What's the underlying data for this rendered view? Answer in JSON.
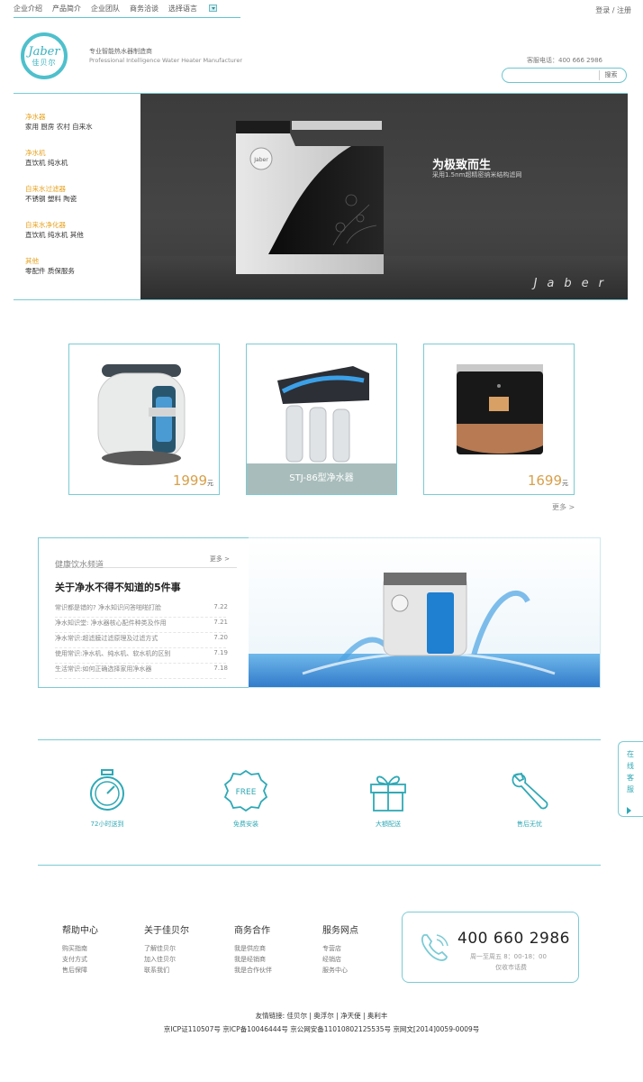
{
  "top_nav": {
    "items": [
      "企业介绍",
      "产品简介",
      "企业团队",
      "商务洽谈",
      "选择语言"
    ],
    "login": "登录 / 注册"
  },
  "header": {
    "logo_text": "Jaber",
    "logo_cn": "佳贝尔",
    "tagline_cn": "专业智能热水器制造商",
    "tagline_en": "Professional Intelligence Water Heater Manufacturer",
    "hotline": "客服电话：400 666 2986",
    "search_placeholder": "",
    "search_button": "搜索"
  },
  "sidebar": {
    "categories": [
      {
        "title": "净水器",
        "subs": "家用  厨房  农村  自来水"
      },
      {
        "title": "净水机",
        "subs": "直饮机  纯水机"
      },
      {
        "title": "自来水过滤器",
        "subs": "不锈钢  塑料  陶瓷"
      },
      {
        "title": "自来水净化器",
        "subs": "直饮机  纯水机  其他"
      },
      {
        "title": "其他",
        "subs": "零配件  质保服务"
      }
    ]
  },
  "banner": {
    "title": "为极致而生",
    "subtitle": "采用1.5nm超精密纳米结构滤网",
    "brand": "Jaber",
    "product_logo": "Jaber"
  },
  "products": [
    {
      "price": "1999",
      "unit": "元"
    },
    {
      "caption": "STJ-86型净水器"
    },
    {
      "price": "1699",
      "unit": "元"
    }
  ],
  "products_more": "更多 >",
  "news": {
    "heading": "健康饮水频道",
    "more": "更多 >",
    "title": "关于净水不得不知道的5件事",
    "items": [
      {
        "text": "常识都是错的? 净水知识问答啪啪打脸",
        "date": "7.22"
      },
      {
        "text": "净水知识堂: 净水器核心配件种类及作用",
        "date": "7.21"
      },
      {
        "text": "净水常识:超滤膜过滤原理及过滤方式",
        "date": "7.20"
      },
      {
        "text": "使用常识:净水机、纯水机、软水机的区别",
        "date": "7.19"
      },
      {
        "text": "生活常识:如何正确选择家用净水器",
        "date": "7.18"
      }
    ]
  },
  "services": [
    {
      "label": "72小时送到",
      "icon": "stopwatch-icon"
    },
    {
      "label": "免费安装",
      "icon": "free-badge-icon",
      "badge": "FREE"
    },
    {
      "label": "大額配送",
      "icon": "gift-icon"
    },
    {
      "label": "售后无忧",
      "icon": "wrench-icon"
    }
  ],
  "online_service": "在线客服",
  "footer": {
    "columns": [
      {
        "heading": "帮助中心",
        "items": [
          "购买指南",
          "支付方式",
          "售后保障"
        ]
      },
      {
        "heading": "关于佳贝尔",
        "items": [
          "了解佳贝尔",
          "加入佳贝尔",
          "联系我们"
        ]
      },
      {
        "heading": "商务合作",
        "items": [
          "我是供应商",
          "我是经销商",
          "我是合作伙伴"
        ]
      },
      {
        "heading": "服务网点",
        "items": [
          "专营店",
          "经销店",
          "服务中心"
        ]
      }
    ],
    "phone": "400 660 2986",
    "phone_hours": "周一至周五 8：00-18：00",
    "phone_note": "仅收市话费",
    "links": "友情链接: 佳贝尔 | 奥浮尔 | 净天使 | 奥利丰",
    "icp": "京ICP证110507号 京ICP备10046444号 京公网安备11010802125535号 京网文[2014]0059-0009号"
  },
  "colors": {
    "accent": "#4ec0cc",
    "price": "#d8a04a",
    "category": "#e6a321"
  }
}
